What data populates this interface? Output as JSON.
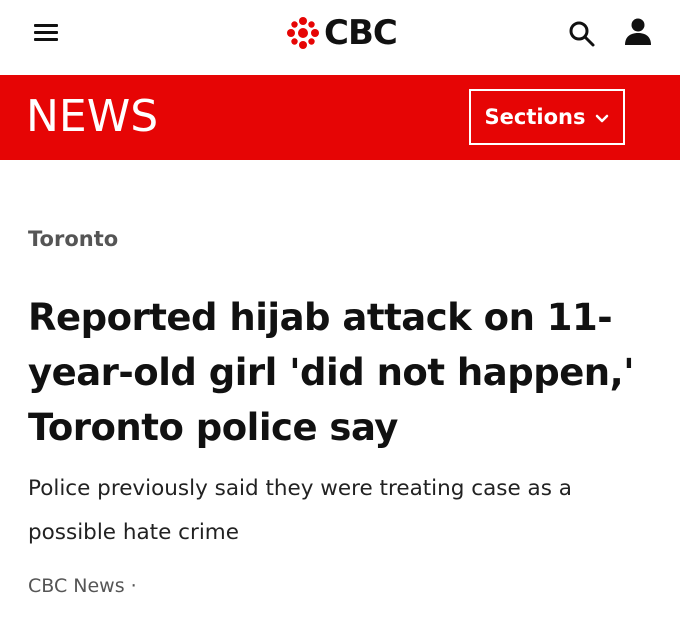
{
  "header": {
    "logo_text": "CBC",
    "news_title": "NEWS",
    "sections_label": "Sections"
  },
  "article": {
    "category": "Toronto",
    "headline": "Reported hijab attack on 11-year-old girl 'did not happen,' Toronto police say",
    "dek": "Police previously said they were treating case as a possible hate crime",
    "byline": "CBC News ·"
  },
  "colors": {
    "brand_red": "#e60505",
    "text_dark": "#111111",
    "text_muted": "#555555"
  },
  "icons": {
    "menu": "hamburger-icon",
    "logo": "cbc-gem-icon",
    "search": "search-icon",
    "user": "user-icon",
    "sections_chevron": "chevron-down-icon"
  }
}
